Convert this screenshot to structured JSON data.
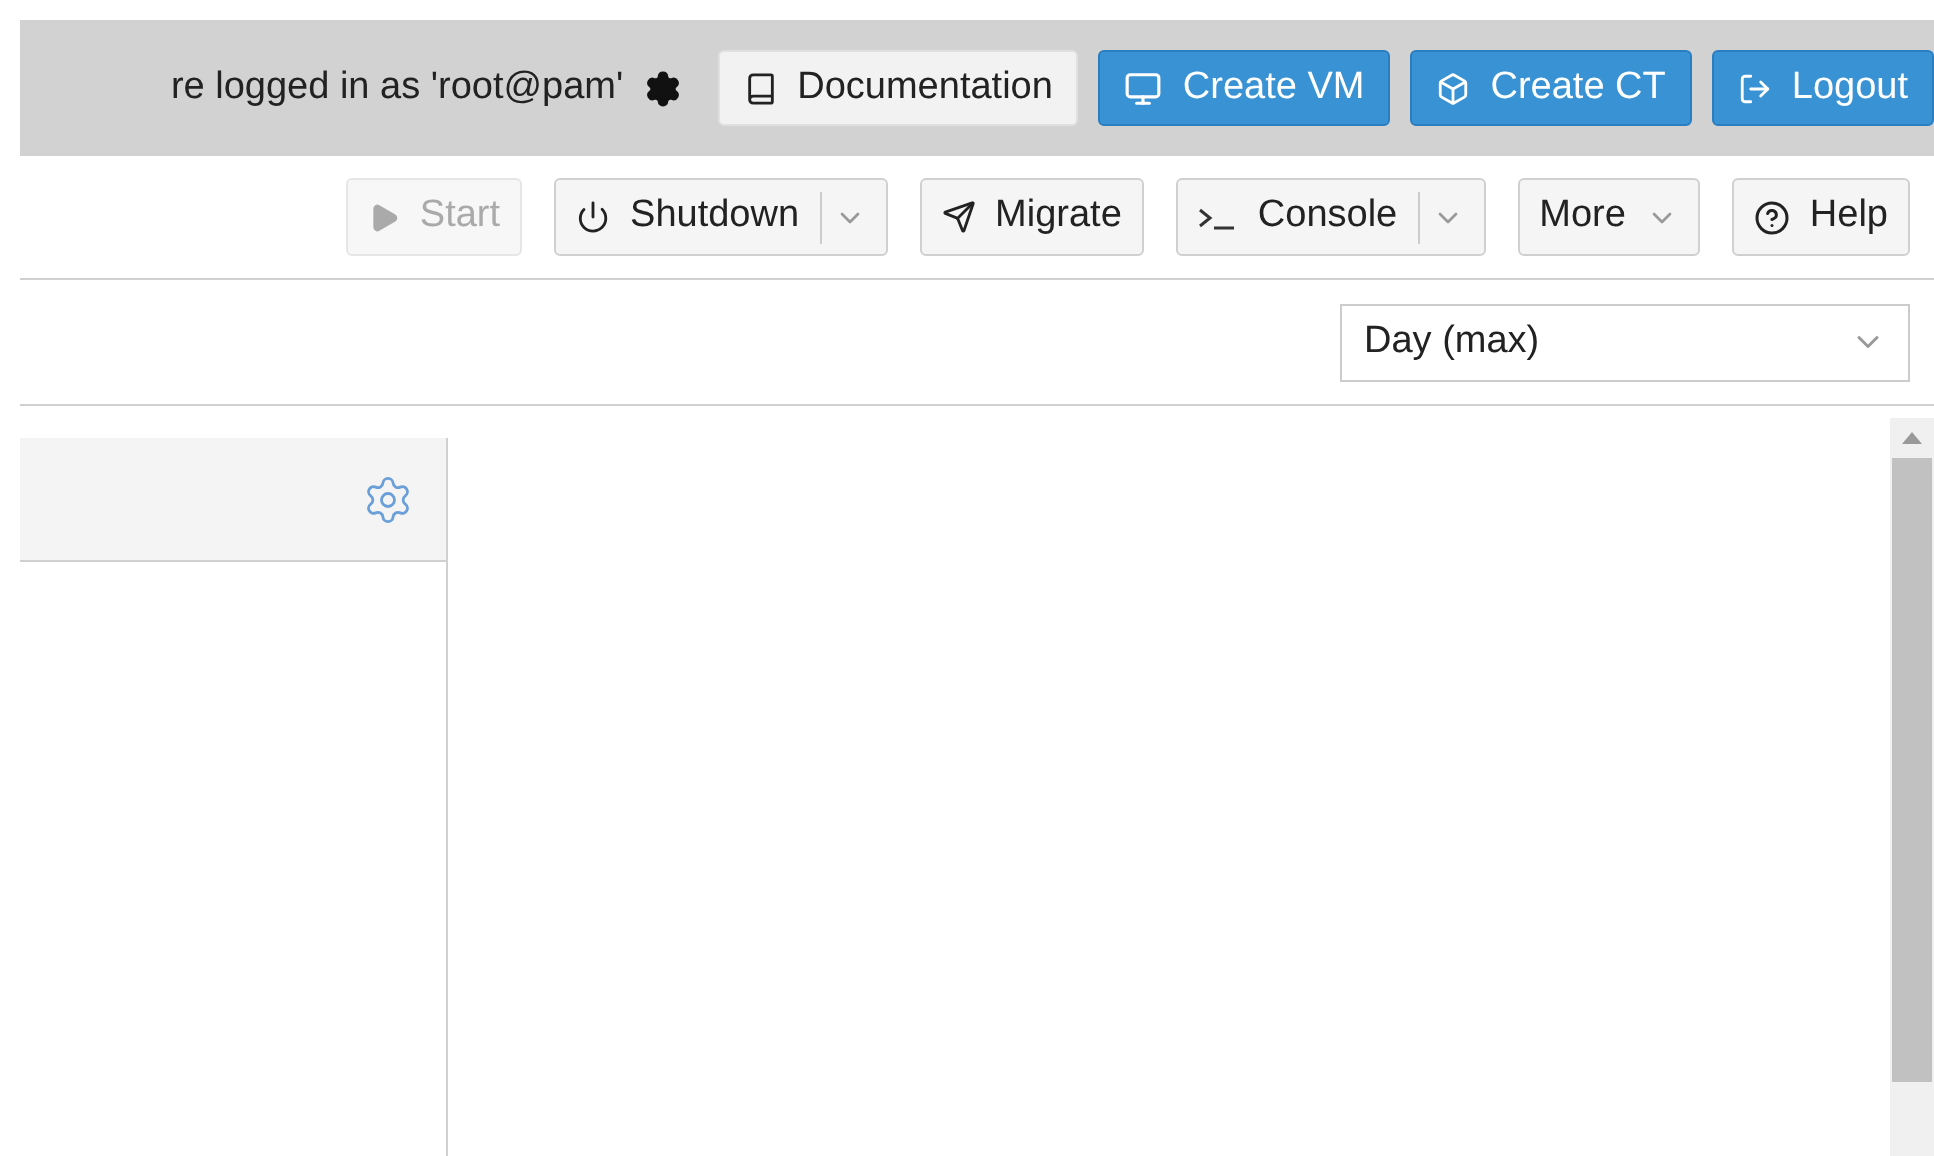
{
  "header": {
    "login_text": "re logged in as 'root@pam'",
    "buttons": [
      {
        "label": "Documentation",
        "kind": "plain"
      },
      {
        "label": "Create VM",
        "kind": "primary"
      },
      {
        "label": "Create CT",
        "kind": "primary"
      },
      {
        "label": "Logout",
        "kind": "primary"
      }
    ]
  },
  "toolbar": {
    "buttons": [
      {
        "label": "Start",
        "kind": "plain",
        "disabled": true
      },
      {
        "label": "Shutdown",
        "kind": "split",
        "disabled": false
      },
      {
        "label": "Migrate",
        "kind": "plain",
        "disabled": false
      },
      {
        "label": "Console",
        "kind": "split",
        "disabled": false
      },
      {
        "label": "More",
        "kind": "menu",
        "disabled": false
      },
      {
        "label": "Help",
        "kind": "plain",
        "disabled": false
      }
    ]
  },
  "timeframe": {
    "value": "Day (max)"
  }
}
